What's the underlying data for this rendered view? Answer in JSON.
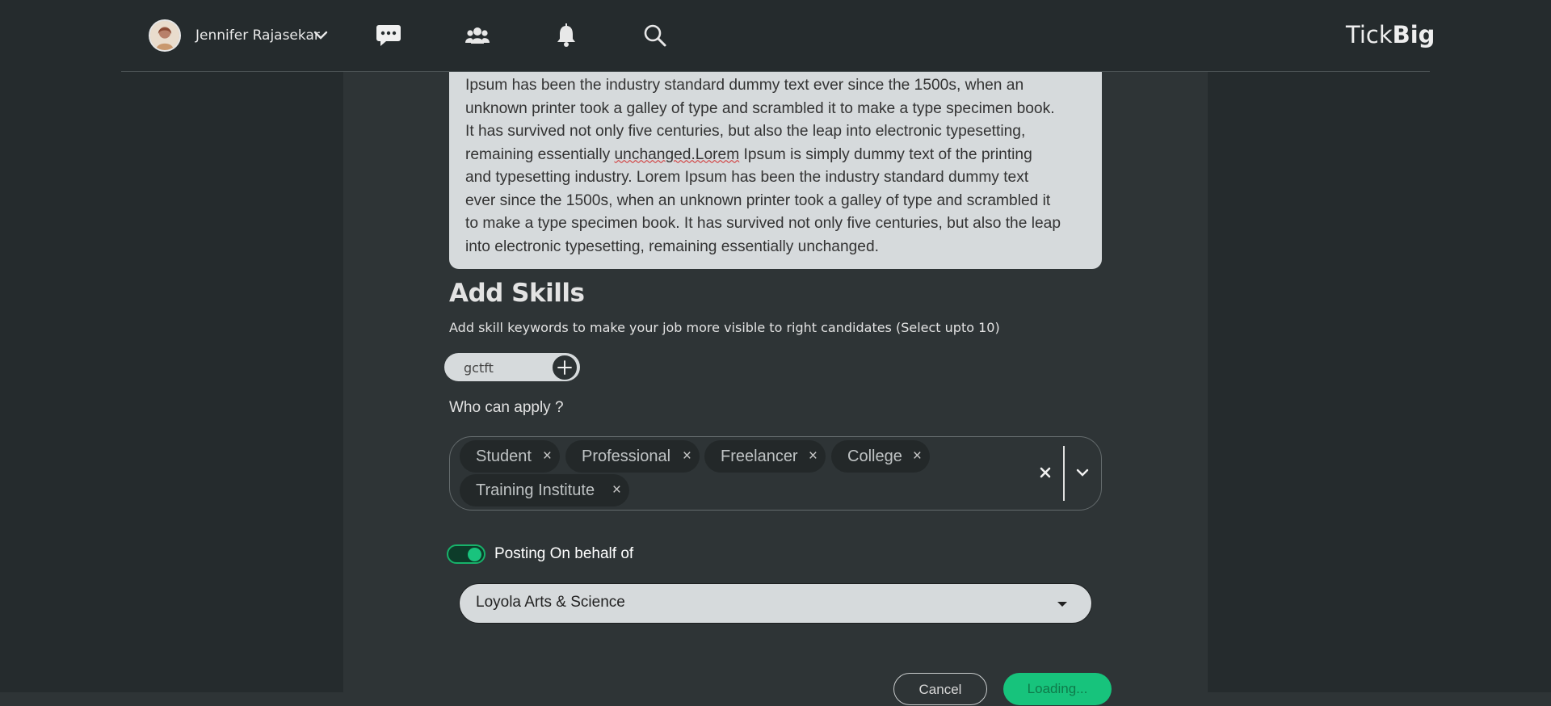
{
  "header": {
    "user_name": "Jennifer Rajasekar",
    "brand_light": "Tick",
    "brand_bold": "Big",
    "nav_icons": [
      "chat-icon",
      "people-icon",
      "bell-icon",
      "search-icon"
    ]
  },
  "description": {
    "text_before": "Ipsum has been the industry standard dummy text ever since the 1500s, when an\nunknown printer took a galley of type and scrambled it to make a type specimen book.\nIt has survived not only five centuries, but also the leap into electronic typesetting,\nremaining essentially ",
    "text_flagged": "unchanged.Lorem",
    "text_after": " Ipsum is simply dummy text of the printing\nand typesetting industry. Lorem Ipsum has been the industry standard dummy text\never since the 1500s, when an unknown printer took a galley of type and scrambled it\nto make a type specimen book. It has survived not only five centuries, but also the leap\ninto electronic typesetting, remaining essentially unchanged."
  },
  "skills": {
    "title": "Add Skills",
    "subtitle": "Add skill keywords to make your job more visible to right candidates (Select upto 10)",
    "input_value": "gctft"
  },
  "who_can_apply": {
    "label": "Who can apply ?",
    "chips": [
      "Student",
      "Professional",
      "Freelancer",
      "College",
      "Training Institute"
    ],
    "remove_glyph": "×"
  },
  "posting": {
    "toggle_on": true,
    "label": "Posting On behalf of",
    "selected": "Loyola Arts & Science"
  },
  "actions": {
    "cancel": "Cancel",
    "submit": "Loading..."
  },
  "colors": {
    "accent_green": "#17c37c",
    "page_bg": "#2e3436",
    "topbar_bg": "#252b2d"
  }
}
